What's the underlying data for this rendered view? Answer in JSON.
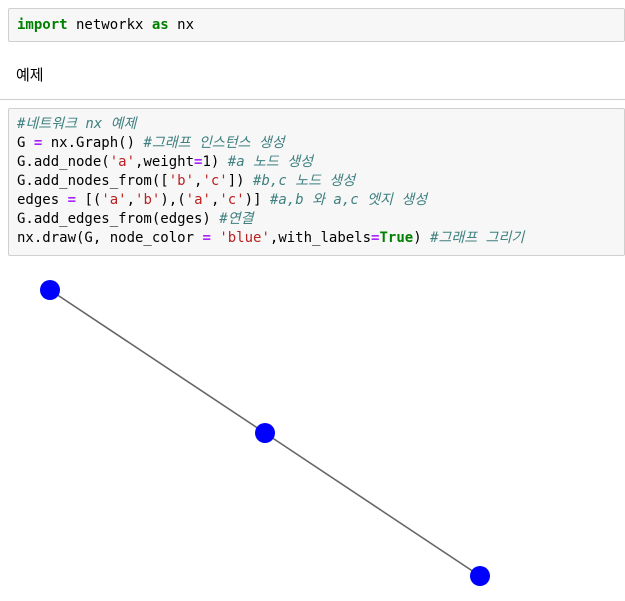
{
  "cell_import": {
    "keyword_import": "import",
    "module": " networkx ",
    "keyword_as": "as",
    "alias": " nx"
  },
  "markdown": {
    "text": "예제"
  },
  "code": {
    "line1": "#네트워크 nx 예제",
    "line2_a": "G ",
    "line2_op": "=",
    "line2_b": " nx.Graph() ",
    "line2_cm": "#그래프 인스턴스 생성",
    "line3_a": "G.add_node(",
    "line3_s": "'a'",
    "line3_b": ",weight",
    "line3_op": "=",
    "line3_c": "1) ",
    "line3_cm": "#a 노드 생성",
    "line4_a": "G.add_nodes_from([",
    "line4_s1": "'b'",
    "line4_b": ",",
    "line4_s2": "'c'",
    "line4_c": "]) ",
    "line4_cm": "#b,c 노드 생성",
    "line5_a": "edges ",
    "line5_op": "=",
    "line5_b": " [(",
    "line5_s1": "'a'",
    "line5_c": ",",
    "line5_s2": "'b'",
    "line5_d": "),(",
    "line5_s3": "'a'",
    "line5_e": ",",
    "line5_s4": "'c'",
    "line5_f": ")] ",
    "line5_cm": "#a,b 와 a,c 엣지 생성",
    "line6_a": "G.add_edges_from(edges) ",
    "line6_cm": "#연결",
    "line7_a": "nx.draw(G, node_color ",
    "line7_op": "=",
    "line7_b": " ",
    "line7_s": "'blue'",
    "line7_c": ",with_labels",
    "line7_op2": "=",
    "line7_kw": "True",
    "line7_d": ") ",
    "line7_cm": "#그래프 그리기"
  },
  "graph": {
    "node_color": "#0000ff",
    "edge_color": "#666666"
  },
  "colors": {
    "keyword": "#008000",
    "comment": "#408080",
    "string": "#ba2121",
    "operator": "#aa22ff",
    "cell_background": "#f7f7f7",
    "cell_border": "#cfcfcf"
  }
}
